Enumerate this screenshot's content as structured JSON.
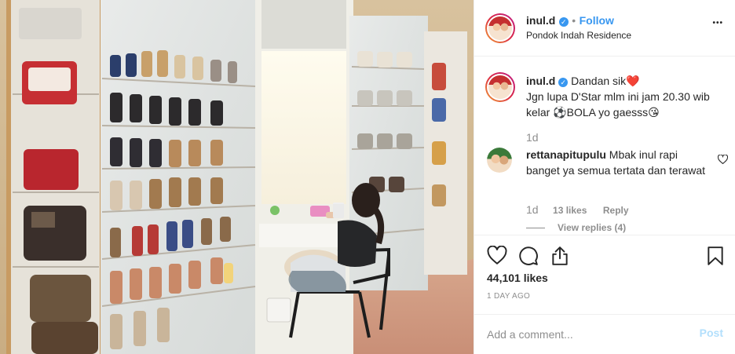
{
  "post": {
    "username": "inul.d",
    "follow_label": "Follow",
    "separator": "•",
    "location": "Pondok Indah Residence",
    "more_label": "•••"
  },
  "caption": {
    "username": "inul.d",
    "line1": "Dandan sik❤️",
    "line2": "Jgn lupa D'Star mlm ini jam 20.30 wib",
    "line3": "kelar ⚽BOLA yo gaesss😘",
    "time": "1d"
  },
  "comment": {
    "username": "rettanapitupulu",
    "text": "Mbak inul rapi banget ya semua tertata dan terawat",
    "time": "1d",
    "likes": "13 likes",
    "reply_label": "Reply",
    "view_replies": "View replies (4)"
  },
  "stats": {
    "likes": "44,101 likes",
    "ago": "1 DAY AGO"
  },
  "add_comment": {
    "placeholder": "Add a comment...",
    "post_label": "Post"
  },
  "colors": {
    "accent": "#3897f0",
    "post_disabled": "#b2dffc",
    "heart": "#ed4956"
  },
  "icons": [
    "verified-icon",
    "more-icon",
    "heart-icon",
    "comment-icon",
    "share-icon",
    "bookmark-icon",
    "comment-like-icon"
  ]
}
